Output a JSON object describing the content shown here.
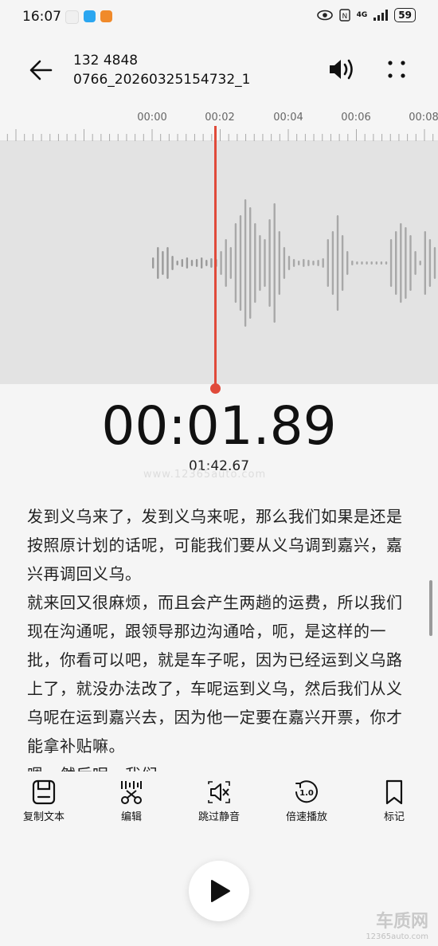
{
  "status_bar": {
    "time": "16:07",
    "network": "4G",
    "battery": "59"
  },
  "header": {
    "title_line1": "132 4848",
    "title_line2": "0766_20260325154732_1"
  },
  "timeline": {
    "ticks": [
      "00:00",
      "00:02",
      "00:04",
      "00:06",
      "00:08"
    ]
  },
  "playback": {
    "current_time": "00:01.89",
    "total_time": "01:42.67"
  },
  "transcript": {
    "paragraphs": [
      "发到义乌来了，发到义乌来呢，那么我们如果是还是按照原计划的话呢，可能我们要从义乌调到嘉兴，嘉兴再调回义乌。",
      "就来回又很麻烦，而且会产生两趟的运费，所以我们现在沟通呢，跟领导那边沟通哈，呃，是这样的一批，你看可以吧，就是车子呢，因为已经运到义乌路上了，就没办法改了，车呢运到义乌，然后我们从义乌呢在运到嘉兴去，因为他一定要在嘉兴开票，你才能拿补贴嘛。",
      "嗯，然后呢，我们。"
    ]
  },
  "toolbar": {
    "copy_text": "复制文本",
    "edit": "编辑",
    "skip_silence": "跳过静音",
    "speed": "倍速播放",
    "speed_value": "1.0",
    "mark": "标记"
  },
  "watermark": {
    "center": "www.12365auto.com",
    "logo": "车质网",
    "url": "12365auto.com"
  },
  "colors": {
    "accent": "#e04a3a",
    "background": "#f5f5f5",
    "wave_bg": "#e3e3e3"
  }
}
